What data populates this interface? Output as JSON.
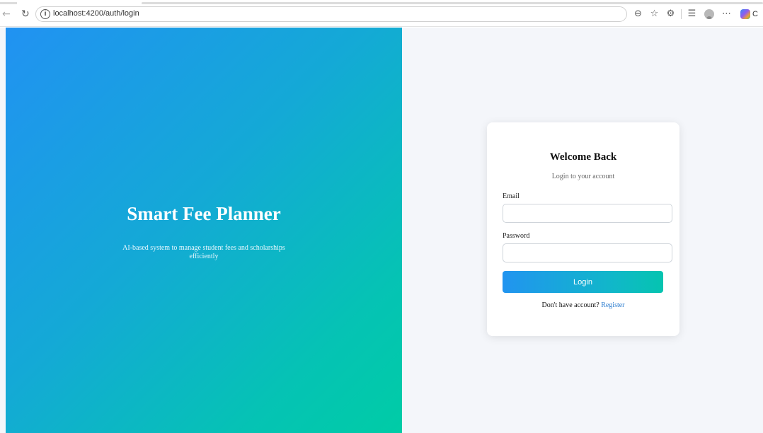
{
  "browser": {
    "url": "localhost:4200/auth/login",
    "back_icon": "back-arrow-icon",
    "reload_icon": "reload-icon",
    "toolbar_icons": [
      "zoom-out-icon",
      "favorite-star-icon",
      "extensions-icon",
      "favorites-list-icon",
      "profile-avatar-icon",
      "more-options-icon",
      "copilot-icon"
    ],
    "copilot_label": "C"
  },
  "hero": {
    "title": "Smart Fee Planner",
    "subtitle": "AI-based system to manage student fees and scholarships efficiently",
    "gradient_start": "#2192f2",
    "gradient_end": "#00cca6"
  },
  "login_card": {
    "title": "Welcome Back",
    "subtitle": "Login to your account",
    "email_label": "Email",
    "email_value": "",
    "password_label": "Password",
    "password_value": "",
    "login_button_label": "Login",
    "register_prompt": "Don't have account?",
    "register_link_label": "Register",
    "link_color": "#2f7fd0"
  }
}
